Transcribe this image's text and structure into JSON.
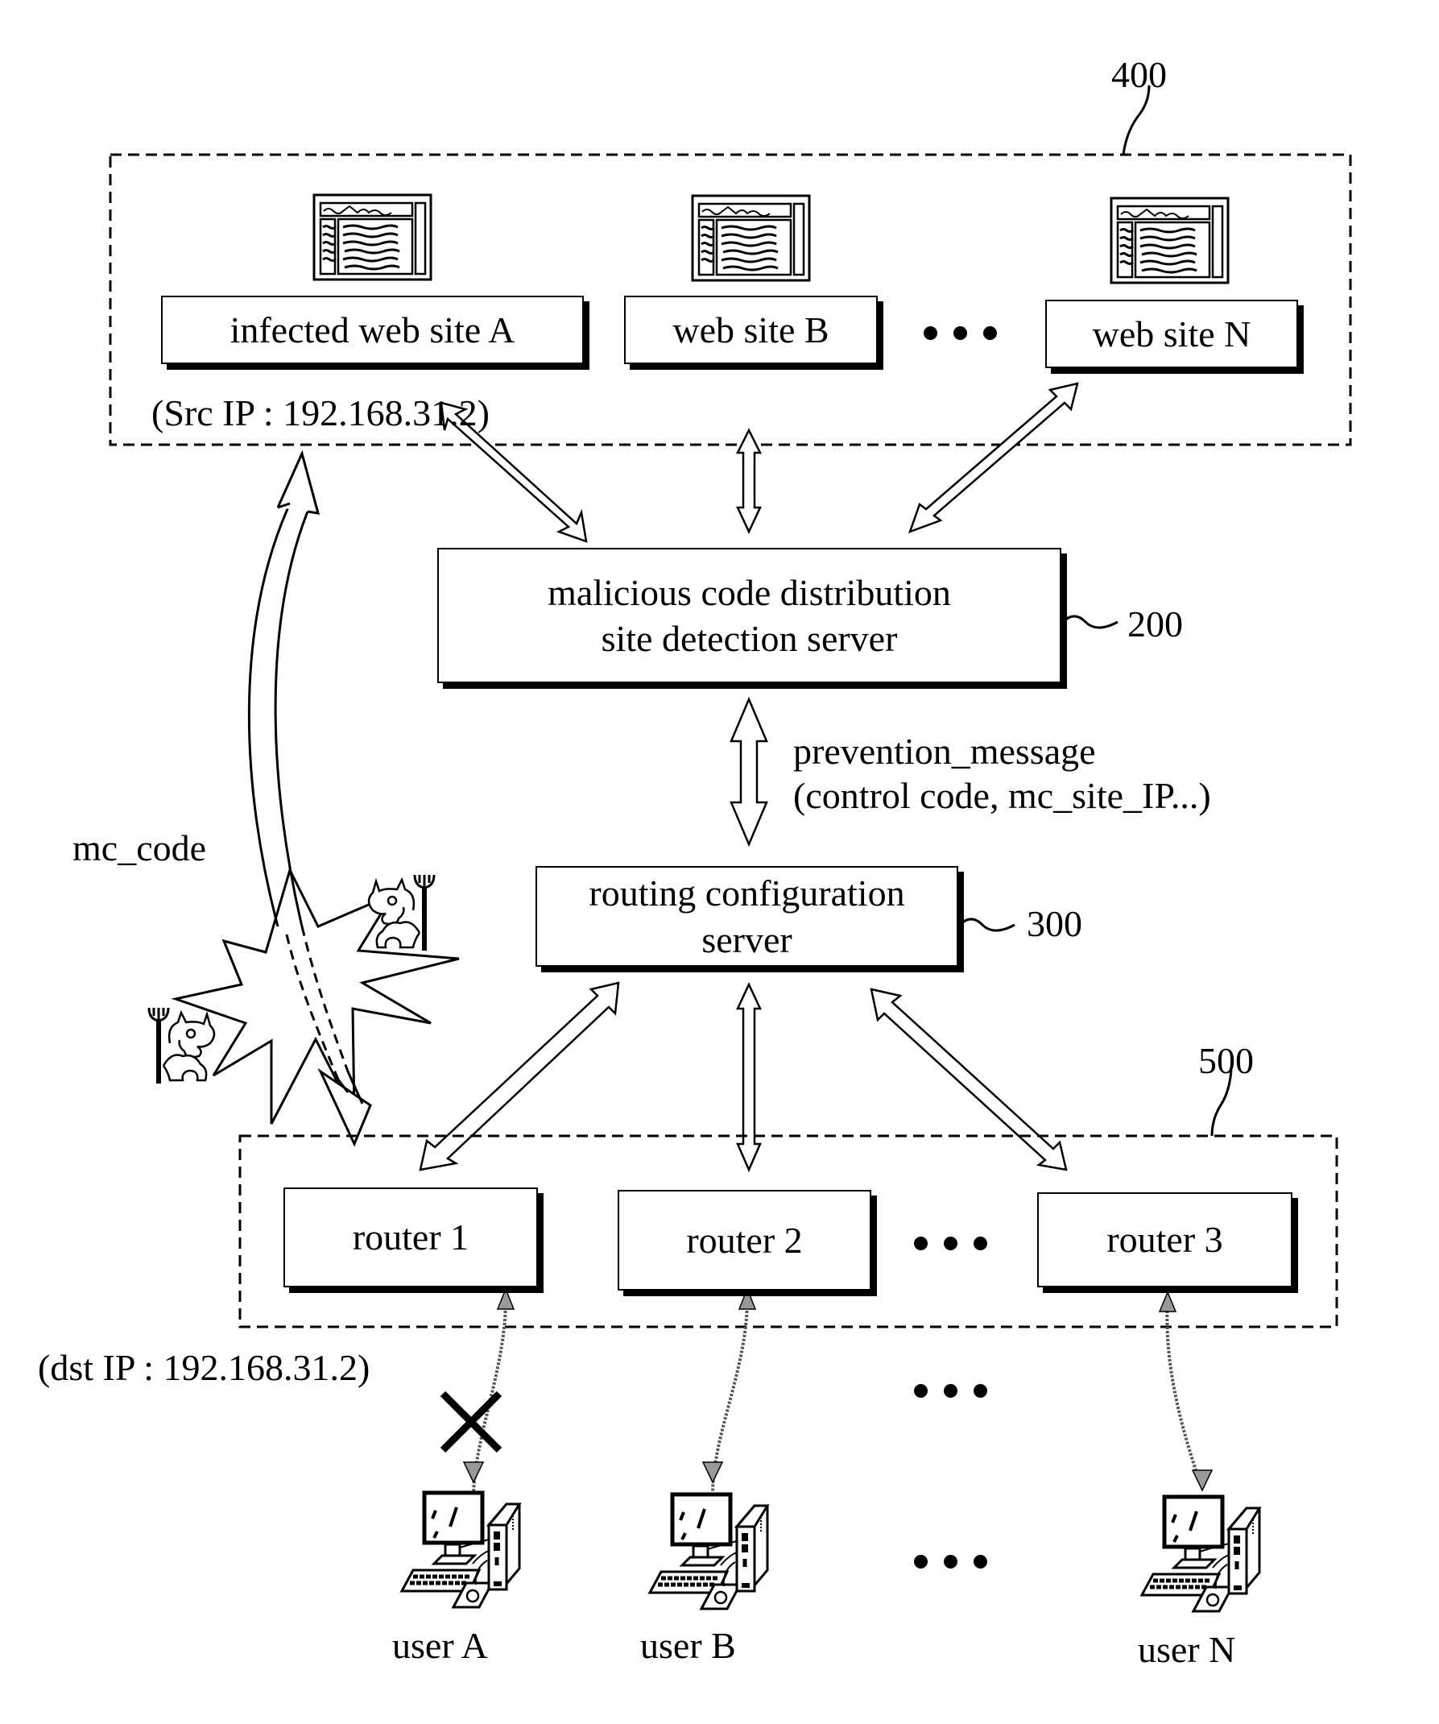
{
  "group_400": {
    "ref": "400",
    "sites": [
      {
        "label": "infected web site A",
        "icon": "web-page-icon"
      },
      {
        "label": "web site B",
        "icon": "web-page-icon"
      },
      {
        "label": "web site N",
        "icon": "web-page-icon"
      }
    ],
    "src_ip": "(Src IP : 192.168.31.2)"
  },
  "detection_server": {
    "line1": "malicious code distribution",
    "line2": "site detection server",
    "ref": "200"
  },
  "prevention_message": {
    "line1": "prevention_message",
    "line2": "(control code, mc_site_IP...)"
  },
  "mc_code": {
    "label": "mc_code",
    "icons": [
      "devil-icon",
      "explosion-icon"
    ]
  },
  "routing_server": {
    "line1": "routing configuration",
    "line2": "server",
    "ref": "300"
  },
  "group_500": {
    "ref": "500",
    "routers": [
      {
        "label": "router 1"
      },
      {
        "label": "router 2"
      },
      {
        "label": "router 3"
      }
    ]
  },
  "dst_ip": "(dst IP : 192.168.31.2)",
  "blocked_marker": "x-mark-icon",
  "users": [
    {
      "label": "user A",
      "icon": "desktop-computer-icon",
      "blocked": true
    },
    {
      "label": "user B",
      "icon": "desktop-computer-icon",
      "blocked": false
    },
    {
      "label": "user N",
      "icon": "desktop-computer-icon",
      "blocked": false
    }
  ]
}
